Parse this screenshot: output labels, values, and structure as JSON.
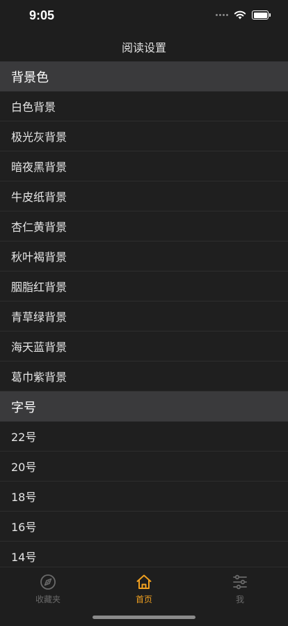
{
  "status_bar": {
    "time": "9:05"
  },
  "nav": {
    "title": "阅读设置"
  },
  "background_section": {
    "title": "背景色",
    "items": [
      "白色背景",
      "极光灰背景",
      "暗夜黑背景",
      "牛皮纸背景",
      "杏仁黄背景",
      "秋叶褐背景",
      "胭脂红背景",
      "青草绿背景",
      "海天蓝背景",
      "葛巾紫背景"
    ]
  },
  "font_section": {
    "title": "字号",
    "items": [
      "22号",
      "20号",
      "18号",
      "16号",
      "14号"
    ]
  },
  "tabs": [
    {
      "label": "收藏夹",
      "icon": "compass-icon",
      "active": false
    },
    {
      "label": "首页",
      "icon": "home-icon",
      "active": true
    },
    {
      "label": "我",
      "icon": "sliders-icon",
      "active": false
    }
  ],
  "colors": {
    "accent": "#f0a020",
    "inactive": "#6a6a6a",
    "header_bg": "#3a3a3c",
    "bg": "#1f1f1f"
  }
}
